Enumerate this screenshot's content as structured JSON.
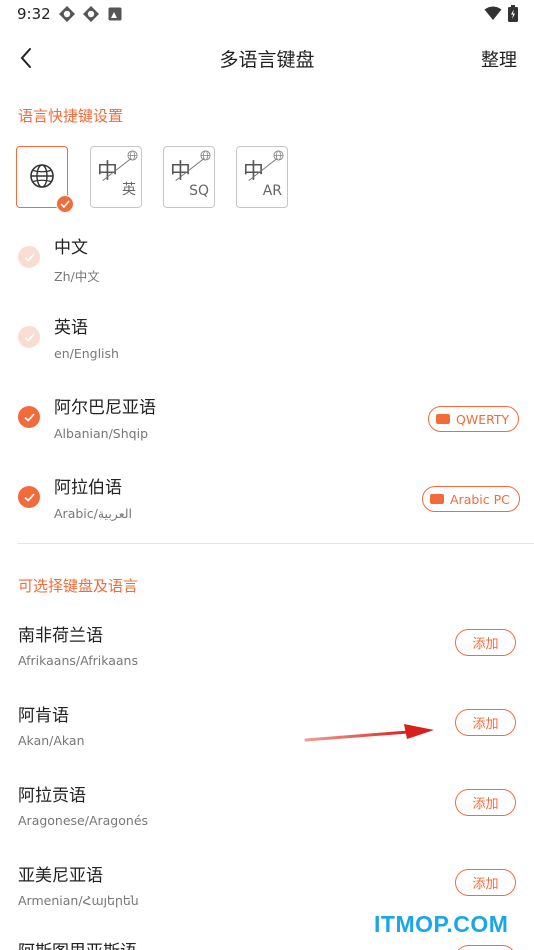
{
  "status_bar": {
    "time": "9:32",
    "icons": [
      "app-notification-icon",
      "app-notification-icon",
      "image-notification-icon"
    ],
    "right_icons": [
      "wifi-icon",
      "battery-icon"
    ]
  },
  "app_bar": {
    "title": "多语言键盘",
    "manage_label": "整理"
  },
  "shortcut_section": {
    "title": "语言快捷键设置",
    "tiles": [
      {
        "main": "",
        "sub": "",
        "icon": "globe-icon",
        "active": true
      },
      {
        "main": "中",
        "sub": "英",
        "icon": "globe-small-icon",
        "active": false
      },
      {
        "main": "中",
        "sub": "SQ",
        "icon": "globe-small-icon",
        "active": false
      },
      {
        "main": "中",
        "sub": "AR",
        "icon": "globe-small-icon",
        "active": false
      }
    ]
  },
  "enabled_languages": [
    {
      "name": "中文",
      "sub": "Zh/中文",
      "state": "disabled",
      "layout": ""
    },
    {
      "name": "英语",
      "sub": "en/English",
      "state": "disabled",
      "layout": ""
    },
    {
      "name": "阿尔巴尼亚语",
      "sub": "Albanian/Shqip",
      "state": "on",
      "layout": "QWERTY"
    },
    {
      "name": "阿拉伯语",
      "sub": "Arabic/العربية",
      "state": "on",
      "layout": "Arabic PC"
    }
  ],
  "available_section": {
    "title": "可选择键盘及语言",
    "add_label": "添加",
    "items": [
      {
        "name": "南非荷兰语",
        "sub": "Afrikaans/Afrikaans"
      },
      {
        "name": "阿肯语",
        "sub": "Akan/Akan"
      },
      {
        "name": "阿拉贡语",
        "sub": "Aragonese/Aragonés"
      },
      {
        "name": "亚美尼亚语",
        "sub": "Armenian/Հայերեն"
      },
      {
        "name": "阿斯图里亚斯语",
        "sub": ""
      }
    ]
  },
  "watermark": "ITMOP.COM",
  "colors": {
    "accent": "#f26b3a",
    "accent_light": "#fbdcd0",
    "annotation_arrow": "#d8201c",
    "watermark": "#1aa6e8"
  }
}
